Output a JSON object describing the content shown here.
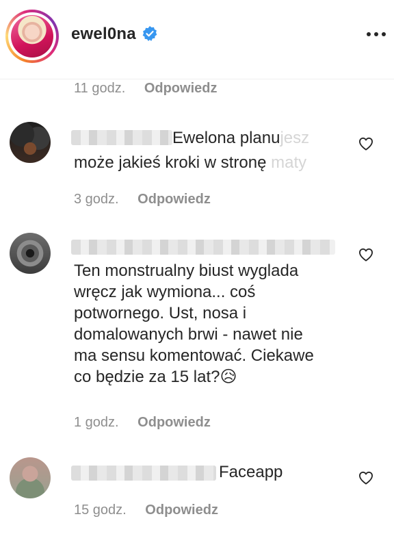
{
  "header": {
    "username": "ewel0na",
    "verified": true,
    "more_icon": "more-dots-icon"
  },
  "top_meta": {
    "time": "11 godz.",
    "reply": "Odpowiedz"
  },
  "comments": [
    {
      "line1_visible": "Ewelona planu",
      "line1_faded": "jesz",
      "line2_visible": "może jakieś kroki w stronę",
      "line2_faded": "maty",
      "time": "3 godz.",
      "reply": "Odpowiedz"
    },
    {
      "text_lines": [
        "Ten monstrualny biust wyglada",
        "wręcz jak wymiona... coś",
        "potwornego. Ust, nosa i",
        "domalowanych brwi - nawet nie",
        "ma sensu komentować. Ciekawe",
        "co będzie za 15 lat?😥"
      ],
      "time": "1 godz.",
      "reply": "Odpowiedz"
    },
    {
      "text": "Faceapp",
      "time": "15 godz.",
      "reply": "Odpowiedz"
    }
  ],
  "colors": {
    "text": "#262626",
    "meta": "#8e8e8e",
    "verified": "#3897f0"
  }
}
